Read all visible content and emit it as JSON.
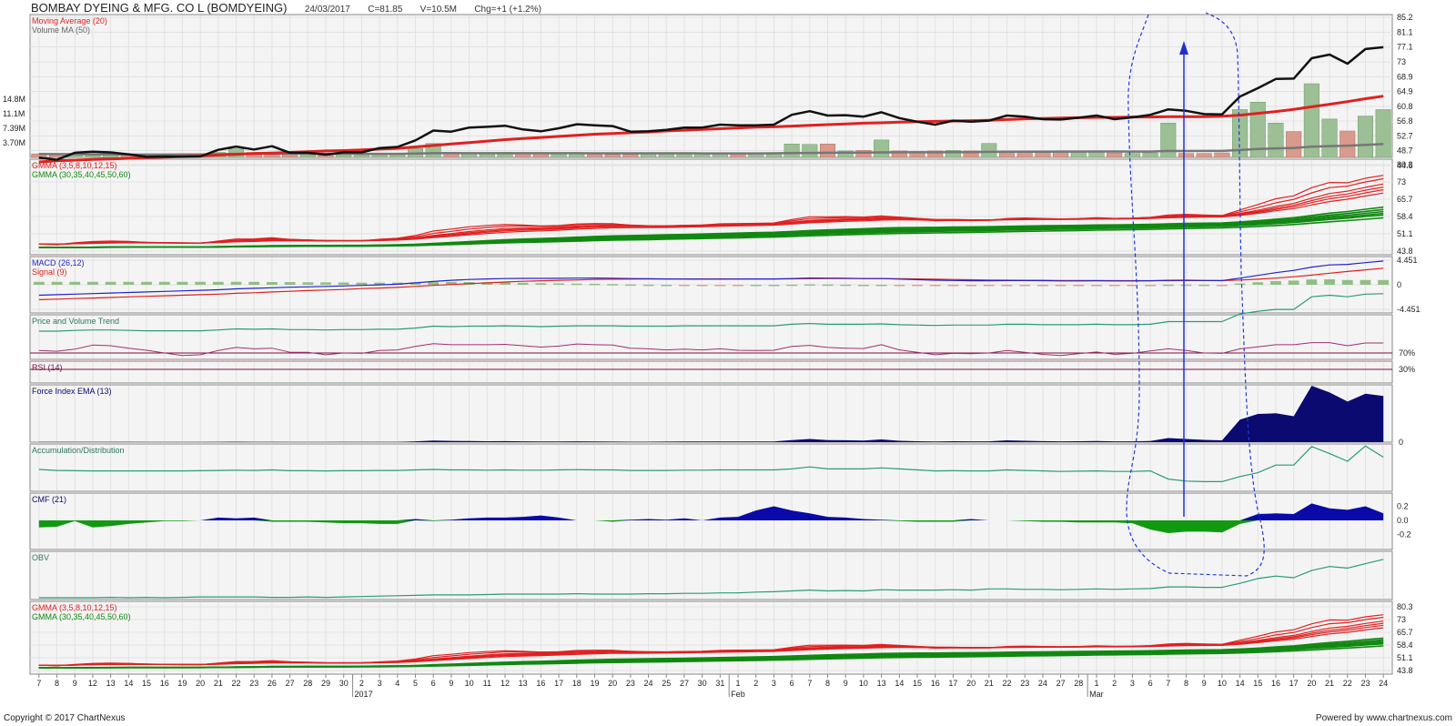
{
  "header": {
    "title": "BOMBAY DYEING & MFG. CO L (BOMDYEING)",
    "date": "24/03/2017",
    "close": "C=81.85",
    "volume": "V=10.5M",
    "change": "Chg=+1 (+1.2%)"
  },
  "footer": {
    "copyright": "Copyright © 2017 ChartNexus",
    "powered": "Powered by www.chartnexus.com"
  },
  "x_axis": {
    "day_labels": [
      "7",
      "8",
      "9",
      "12",
      "13",
      "14",
      "15",
      "16",
      "19",
      "20",
      "21",
      "22",
      "23",
      "26",
      "27",
      "28",
      "29",
      "30",
      "2",
      "3",
      "4",
      "5",
      "6",
      "9",
      "10",
      "11",
      "12",
      "13",
      "16",
      "17",
      "18",
      "19",
      "20",
      "23",
      "24",
      "25",
      "27",
      "30",
      "31",
      "1",
      "2",
      "3",
      "6",
      "7",
      "8",
      "9",
      "10",
      "13",
      "14",
      "15",
      "16",
      "17",
      "20",
      "21",
      "22",
      "23",
      "24",
      "27",
      "28",
      "1",
      "2",
      "3",
      "6",
      "7",
      "8",
      "9",
      "10",
      "14",
      "15",
      "16",
      "17",
      "20",
      "21",
      "22",
      "23",
      "24"
    ],
    "period_labels": [
      {
        "index": 18,
        "label": "2017"
      },
      {
        "index": 39,
        "label": "Feb"
      },
      {
        "index": 59,
        "label": "Mar"
      }
    ]
  },
  "chart_data": [
    {
      "panel": "price",
      "type": "line",
      "legend": [
        "Moving Average (20)",
        "Volume MA (50)"
      ],
      "y_ticks": [
        "85.2",
        "81.1",
        "77.1",
        "73",
        "68.9",
        "64.9",
        "60.8",
        "56.8",
        "52.7",
        "48.7",
        "44.6"
      ],
      "ylim": [
        44.6,
        85.2
      ],
      "volume_ticks": [
        "14.8M",
        "11.1M",
        "7.39M",
        "3.70M"
      ],
      "close": [
        46.8,
        46.2,
        48.1,
        48.4,
        48.2,
        47.7,
        47.0,
        47.1,
        47.0,
        47.1,
        48.9,
        49.8,
        49.0,
        49.9,
        48.1,
        48.1,
        47.6,
        48.2,
        48.2,
        49.4,
        49.7,
        51.5,
        54.2,
        53.9,
        55.0,
        55.2,
        55.5,
        54.5,
        54.0,
        54.8,
        55.9,
        55.6,
        55.4,
        53.9,
        54.0,
        54.4,
        55.0,
        55.0,
        55.8,
        55.6,
        55.6,
        55.8,
        58.5,
        59.5,
        58.3,
        58.4,
        58.0,
        59.2,
        57.6,
        56.6,
        55.8,
        56.9,
        56.6,
        56.9,
        58.3,
        58.0,
        57.3,
        57.2,
        57.7,
        58.3,
        57.3,
        57.8,
        58.5,
        60.0,
        59.6,
        58.7,
        58.6,
        63.5,
        65.8,
        68.3,
        68.4,
        74.0,
        75.0,
        72.5,
        76.5,
        77.0
      ],
      "ma20": [
        45.6,
        45.9,
        46.1,
        46.3,
        46.4,
        46.6,
        46.8,
        46.9,
        47.1,
        47.3,
        47.5,
        47.7,
        47.9,
        48.0,
        48.2,
        48.4,
        48.6,
        48.7,
        48.9,
        49.1,
        49.3,
        49.7,
        50.1,
        50.5,
        50.9,
        51.3,
        51.7,
        52.0,
        52.3,
        52.6,
        52.9,
        53.2,
        53.4,
        53.6,
        53.8,
        54.1,
        54.3,
        54.5,
        54.7,
        54.9,
        55.1,
        55.2,
        55.4,
        55.6,
        55.8,
        56.0,
        56.2,
        56.3,
        56.5,
        56.6,
        56.7,
        56.8,
        56.9,
        57.0,
        57.2,
        57.4,
        57.5,
        57.6,
        57.7,
        57.8,
        57.8,
        57.9,
        57.9,
        58.0,
        58.0,
        58.0,
        58.1,
        58.4,
        58.9,
        59.4,
        60.0,
        60.7,
        61.4,
        62.1,
        62.9,
        63.6
      ],
      "volume_m": [
        0.7,
        0.6,
        0.6,
        0.5,
        0.5,
        0.5,
        0.6,
        0.6,
        0.6,
        0.6,
        1.0,
        1.7,
        1.0,
        0.7,
        0.9,
        0.6,
        0.5,
        0.8,
        0.6,
        0.6,
        0.7,
        1.8,
        2.8,
        0.9,
        0.8,
        0.7,
        1.0,
        0.8,
        0.7,
        0.7,
        0.8,
        0.7,
        0.6,
        0.6,
        0.7,
        0.8,
        0.8,
        0.7,
        0.7,
        0.9,
        0.9,
        0.9,
        2.7,
        2.6,
        2.7,
        1.3,
        1.4,
        3.5,
        1.3,
        1.2,
        1.3,
        1.4,
        1.3,
        2.8,
        1.3,
        1.3,
        1.3,
        1.2,
        1.2,
        1.2,
        0.9,
        0.8,
        0.9,
        6.9,
        0.8,
        0.8,
        0.9,
        9.6,
        11.1,
        6.9,
        5.2,
        14.8,
        7.7,
        5.3,
        8.3,
        9.6
      ],
      "volume_up": [
        false,
        false,
        true,
        true,
        true,
        false,
        true,
        false,
        true,
        true,
        true,
        true,
        false,
        false,
        false,
        true,
        false,
        true,
        true,
        true,
        true,
        true,
        true,
        false,
        true,
        true,
        true,
        false,
        false,
        true,
        true,
        false,
        false,
        false,
        true,
        true,
        true,
        true,
        true,
        false,
        true,
        true,
        true,
        true,
        false,
        true,
        false,
        true,
        false,
        false,
        false,
        true,
        false,
        true,
        false,
        false,
        false,
        false,
        true,
        true,
        false,
        true,
        true,
        true,
        false,
        false,
        false,
        true,
        true,
        true,
        false,
        true,
        true,
        false,
        true,
        true
      ]
    },
    {
      "panel": "gmma",
      "type": "line",
      "legend": [
        "GMMA (3,5,8,10,12,15)",
        "GMMA (30,35,40,45,50,60)"
      ],
      "y_ticks": [
        "80.3",
        "73",
        "65.7",
        "58.4",
        "51.1",
        "43.8"
      ],
      "ylim": [
        43.8,
        80.3
      ]
    },
    {
      "panel": "macd",
      "type": "line",
      "legend": [
        "MACD (26,12)",
        "Signal (9)"
      ],
      "y_ticks": [
        "4.451",
        "0",
        "-4.451"
      ],
      "ylim": [
        -4.451,
        4.451
      ],
      "macd": [
        -1.9,
        -1.8,
        -1.7,
        -1.6,
        -1.5,
        -1.4,
        -1.3,
        -1.2,
        -1.1,
        -1.0,
        -0.9,
        -0.75,
        -0.65,
        -0.55,
        -0.45,
        -0.38,
        -0.3,
        -0.22,
        -0.12,
        -0.02,
        0.1,
        0.35,
        0.6,
        0.8,
        0.95,
        1.05,
        1.12,
        1.15,
        1.15,
        1.17,
        1.2,
        1.22,
        1.18,
        1.12,
        1.08,
        1.05,
        1.04,
        1.02,
        1.03,
        1.04,
        1.05,
        1.05,
        1.12,
        1.22,
        1.2,
        1.18,
        1.12,
        1.12,
        1.02,
        0.92,
        0.82,
        0.78,
        0.72,
        0.72,
        0.76,
        0.76,
        0.74,
        0.7,
        0.7,
        0.72,
        0.7,
        0.7,
        0.72,
        0.8,
        0.82,
        0.78,
        0.74,
        1.2,
        1.7,
        2.2,
        2.6,
        3.2,
        3.6,
        3.7,
        4.0,
        4.3
      ],
      "signal": [
        -2.7,
        -2.6,
        -2.5,
        -2.4,
        -2.3,
        -2.2,
        -2.1,
        -2.0,
        -1.9,
        -1.8,
        -1.7,
        -1.55,
        -1.45,
        -1.3,
        -1.18,
        -1.05,
        -0.95,
        -0.85,
        -0.7,
        -0.6,
        -0.48,
        -0.3,
        -0.12,
        0.05,
        0.2,
        0.35,
        0.5,
        0.62,
        0.72,
        0.8,
        0.88,
        0.95,
        1.0,
        1.02,
        1.04,
        1.05,
        1.06,
        1.05,
        1.05,
        1.05,
        1.05,
        1.05,
        1.07,
        1.1,
        1.12,
        1.12,
        1.12,
        1.12,
        1.1,
        1.06,
        1.0,
        0.95,
        0.9,
        0.86,
        0.83,
        0.81,
        0.8,
        0.78,
        0.77,
        0.76,
        0.75,
        0.74,
        0.74,
        0.75,
        0.76,
        0.76,
        0.76,
        0.85,
        1.0,
        1.2,
        1.45,
        1.75,
        2.1,
        2.4,
        2.7,
        3.0
      ]
    },
    {
      "panel": "pvt",
      "type": "line",
      "legend": [
        "Price and Volume Trend"
      ],
      "values": [
        0,
        0,
        0.02,
        0.03,
        0.03,
        0.02,
        0.01,
        0.01,
        0.01,
        0.01,
        0.03,
        0.06,
        0.05,
        0.06,
        0.04,
        0.04,
        0.03,
        0.04,
        0.04,
        0.05,
        0.05,
        0.08,
        0.13,
        0.12,
        0.13,
        0.13,
        0.14,
        0.13,
        0.12,
        0.13,
        0.14,
        0.14,
        0.14,
        0.13,
        0.13,
        0.13,
        0.14,
        0.14,
        0.14,
        0.14,
        0.14,
        0.14,
        0.18,
        0.2,
        0.18,
        0.18,
        0.18,
        0.19,
        0.17,
        0.16,
        0.15,
        0.16,
        0.16,
        0.16,
        0.18,
        0.18,
        0.17,
        0.17,
        0.17,
        0.18,
        0.17,
        0.17,
        0.18,
        0.25,
        0.25,
        0.25,
        0.25,
        0.45,
        0.52,
        0.57,
        0.57,
        0.9,
        0.94,
        0.9,
        0.97,
        0.98
      ]
    },
    {
      "panel": "rsi",
      "type": "line",
      "legend": [
        "RSI (14)"
      ],
      "y_ticks": [
        "70%",
        "30%"
      ],
      "ylim": [
        0,
        100
      ],
      "values": [
        62,
        60,
        66,
        78,
        76,
        69,
        63,
        55,
        48,
        50,
        62,
        71,
        67,
        69,
        57,
        57,
        50,
        55,
        54,
        62,
        64,
        74,
        82,
        79,
        79,
        79,
        80,
        76,
        72,
        75,
        81,
        79,
        78,
        69,
        67,
        64,
        66,
        64,
        67,
        63,
        62,
        63,
        74,
        77,
        71,
        69,
        68,
        79,
        64,
        57,
        50,
        54,
        53,
        55,
        62,
        57,
        51,
        48,
        53,
        58,
        51,
        54,
        61,
        67,
        62,
        55,
        54,
        67,
        73,
        79,
        79,
        85,
        85,
        76,
        84,
        84
      ]
    },
    {
      "panel": "force_index",
      "type": "area",
      "legend": [
        "Force Index EMA (13)"
      ],
      "values": [
        0.1,
        0.08,
        0.1,
        0.12,
        0.1,
        0.08,
        0.06,
        0.06,
        0.06,
        0.06,
        0.12,
        0.2,
        0.1,
        0.1,
        0.06,
        0.06,
        0.05,
        0.08,
        0.07,
        0.1,
        0.12,
        0.35,
        0.7,
        0.55,
        0.5,
        0.42,
        0.45,
        0.35,
        0.28,
        0.3,
        0.35,
        0.3,
        0.25,
        0.2,
        0.22,
        0.25,
        0.3,
        0.28,
        0.3,
        0.28,
        0.28,
        0.3,
        0.9,
        1.4,
        0.9,
        0.85,
        0.7,
        1.2,
        0.6,
        0.4,
        0.3,
        0.4,
        0.35,
        0.35,
        0.8,
        0.6,
        0.45,
        0.35,
        0.4,
        0.5,
        0.35,
        0.35,
        0.5,
        1.8,
        1.4,
        1.0,
        0.8,
        10,
        12.5,
        12.8,
        11.5,
        25,
        22,
        18,
        21.5,
        20.5
      ]
    },
    {
      "panel": "ad",
      "type": "line",
      "legend": [
        "Accumulation/Distribution"
      ],
      "values": [
        0.68,
        0.64,
        0.63,
        0.62,
        0.62,
        0.62,
        0.62,
        0.62,
        0.62,
        0.63,
        0.64,
        0.65,
        0.64,
        0.66,
        0.63,
        0.63,
        0.62,
        0.63,
        0.63,
        0.64,
        0.64,
        0.66,
        0.68,
        0.66,
        0.66,
        0.65,
        0.66,
        0.65,
        0.65,
        0.66,
        0.67,
        0.66,
        0.66,
        0.64,
        0.64,
        0.64,
        0.65,
        0.65,
        0.66,
        0.66,
        0.66,
        0.66,
        0.7,
        0.78,
        0.7,
        0.7,
        0.7,
        0.74,
        0.7,
        0.66,
        0.62,
        0.63,
        0.62,
        0.62,
        0.66,
        0.64,
        0.62,
        0.6,
        0.61,
        0.62,
        0.6,
        0.6,
        0.62,
        0.3,
        0.22,
        0.2,
        0.2,
        0.4,
        0.55,
        0.85,
        0.85,
        1.58,
        1.3,
        1.0,
        1.6,
        1.16
      ]
    },
    {
      "panel": "cmf",
      "type": "area",
      "legend": [
        "CMF (21)"
      ],
      "y_ticks": [
        "0.2",
        "0.0",
        "-0.2"
      ],
      "ylim": [
        -0.3,
        0.3
      ],
      "values": [
        -0.1,
        -0.09,
        -0.01,
        -0.1,
        -0.08,
        -0.05,
        -0.03,
        -0.01,
        -0.01,
        0.0,
        0.04,
        0.03,
        0.04,
        -0.02,
        -0.02,
        -0.02,
        -0.03,
        -0.04,
        -0.04,
        -0.05,
        -0.05,
        0.02,
        -0.01,
        0.01,
        0.03,
        0.04,
        0.04,
        0.05,
        0.07,
        0.04,
        0.0,
        0.0,
        -0.02,
        0.01,
        0.02,
        0.01,
        0.03,
        0.0,
        0.04,
        0.05,
        0.14,
        0.2,
        0.14,
        0.1,
        0.05,
        0.04,
        0.02,
        0.01,
        -0.01,
        -0.02,
        -0.02,
        -0.02,
        0.02,
        0.0,
        0.0,
        -0.01,
        -0.02,
        -0.02,
        -0.03,
        -0.03,
        -0.03,
        -0.04,
        -0.13,
        -0.18,
        -0.16,
        -0.16,
        -0.17,
        -0.05,
        0.09,
        0.1,
        0.09,
        0.24,
        0.17,
        0.15,
        0.2,
        0.1
      ]
    },
    {
      "panel": "obv",
      "type": "line",
      "legend": [
        "OBV"
      ],
      "values": [
        0.0,
        0.0,
        0.0,
        0.0,
        0.01,
        0.0,
        0.01,
        0.0,
        0.01,
        0.02,
        0.02,
        0.02,
        0.02,
        0.01,
        0.01,
        0.02,
        0.01,
        0.02,
        0.03,
        0.04,
        0.05,
        0.06,
        0.07,
        0.07,
        0.07,
        0.08,
        0.09,
        0.09,
        0.09,
        0.09,
        0.1,
        0.09,
        0.09,
        0.09,
        0.1,
        0.1,
        0.11,
        0.11,
        0.12,
        0.12,
        0.14,
        0.15,
        0.17,
        0.19,
        0.17,
        0.18,
        0.17,
        0.2,
        0.19,
        0.19,
        0.19,
        0.2,
        0.19,
        0.22,
        0.22,
        0.21,
        0.21,
        0.2,
        0.21,
        0.22,
        0.21,
        0.22,
        0.23,
        0.27,
        0.27,
        0.26,
        0.26,
        0.36,
        0.48,
        0.54,
        0.5,
        0.68,
        0.78,
        0.74,
        0.85,
        0.96
      ]
    },
    {
      "panel": "gmma2",
      "type": "line",
      "legend": [
        "GMMA (3,5,8,10,12,15)",
        "GMMA (30,35,40,45,50,60)"
      ],
      "y_ticks": [
        "80.3",
        "73",
        "65.7",
        "58.4",
        "51.1",
        "43.8"
      ],
      "ylim": [
        43.8,
        80.3
      ]
    }
  ]
}
